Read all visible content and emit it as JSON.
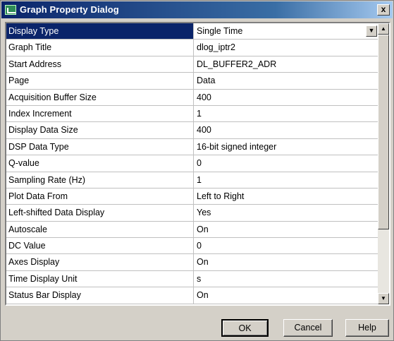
{
  "window": {
    "title": "Graph Property Dialog",
    "close_glyph": "x"
  },
  "properties": [
    {
      "label": "Display Type",
      "value": "Single Time",
      "selected": true
    },
    {
      "label": "Graph Title",
      "value": "dlog_iptr2"
    },
    {
      "label": "Start Address",
      "value": "DL_BUFFER2_ADR"
    },
    {
      "label": "Page",
      "value": "Data"
    },
    {
      "label": "Acquisition Buffer Size",
      "value": "400"
    },
    {
      "label": "Index Increment",
      "value": "1"
    },
    {
      "label": "Display Data Size",
      "value": "400"
    },
    {
      "label": "DSP Data Type",
      "value": "16-bit signed integer"
    },
    {
      "label": "Q-value",
      "value": "0"
    },
    {
      "label": "Sampling Rate (Hz)",
      "value": "1"
    },
    {
      "label": "Plot Data From",
      "value": "Left to Right"
    },
    {
      "label": "Left-shifted Data Display",
      "value": "Yes"
    },
    {
      "label": "Autoscale",
      "value": "On"
    },
    {
      "label": "DC Value",
      "value": "0"
    },
    {
      "label": "Axes Display",
      "value": "On"
    },
    {
      "label": "Time Display Unit",
      "value": "s"
    },
    {
      "label": "Status Bar Display",
      "value": "On"
    }
  ],
  "buttons": {
    "ok": "OK",
    "cancel": "Cancel",
    "help": "Help"
  },
  "colors": {
    "selection": "#0a246a",
    "title_gradient_start": "#0a246a",
    "face": "#d4d0c8"
  }
}
